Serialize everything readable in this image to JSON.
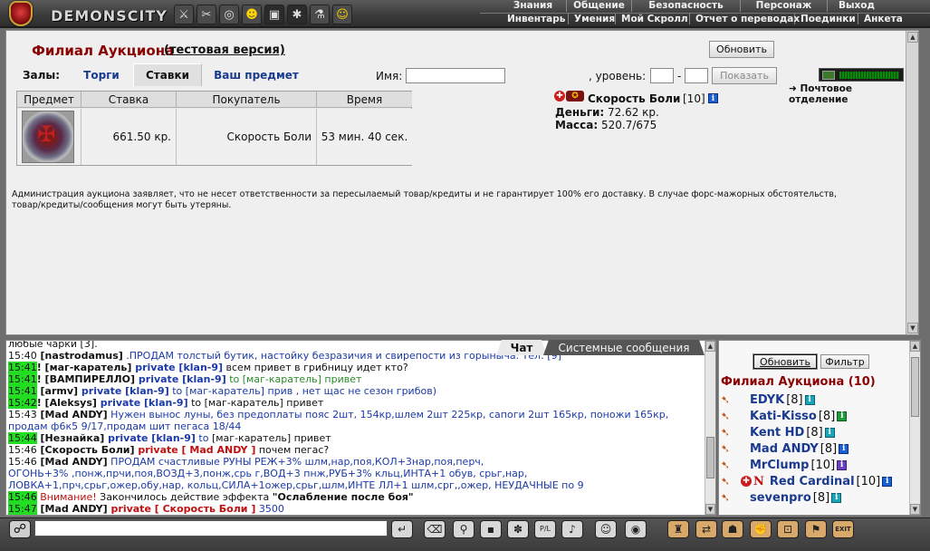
{
  "header": {
    "logo_text": "DEMONSCITY",
    "top_menu": [
      "Знания",
      "Общение",
      "Безопасность",
      "Персонаж",
      "Выход"
    ],
    "sub_menu": [
      "Инвентарь",
      "Умения",
      "Мой Скролл",
      "Отчет о переводах",
      "Поединки",
      "Анкета"
    ]
  },
  "auction": {
    "title": "Филиал Аукциона",
    "subtitle": "(тестовая версия)",
    "refresh_label": "Обновить",
    "halls_label": "Залы:",
    "tabs": [
      "Торги",
      "Ставки",
      "Ваш предмет"
    ],
    "active_tab": "Ставки",
    "name_label": "Имя:",
    "name_value": "",
    "level_label": ", уровень:",
    "level_from": "",
    "level_sep": "-",
    "level_to": "",
    "show_label": "Показать",
    "table": {
      "headers": [
        "Предмет",
        "Ставка",
        "Покупатель",
        "Время"
      ],
      "rows": [
        {
          "bid": "661.50 кр.",
          "buyer": "Скорость Боли",
          "time": "53 мин. 40 сек."
        }
      ]
    },
    "buyer": {
      "name": "Скорость Боли",
      "level": "[10]",
      "money_label": "Деньги:",
      "money_value": "72.62 кр.",
      "mass_label": "Масса:",
      "mass_value": "520.7/675"
    },
    "disclaimer": "Администрация аукциона заявляет, что не несет ответственности за пересылаемый товар/кредиты и не гарантирует 100% его доставку. В случае форс-мажорных обстоятельств, товар/кредиты/сообщения могут быть утеряны.",
    "mail_label": "Почтовое отделение"
  },
  "chat": {
    "tabs": [
      "Чат",
      "Системные сообщения"
    ],
    "lines": [
      {
        "time": "",
        "highlight": false,
        "parts": [
          {
            "t": "любые чарки [3].",
            "c": "n"
          }
        ]
      },
      {
        "time": "15:40",
        "highlight": false,
        "parts": [
          {
            "t": " [nastrodamus]",
            "c": "k"
          },
          {
            "t": " .ПРОДАМ толстый бутик, настойку безразичия и свирепости из горыныча. Тел: [9]",
            "c": "m"
          }
        ]
      },
      {
        "time": "15:41",
        "highlight": true,
        "parts": [
          {
            "t": "! [маг-каратель]",
            "c": "k"
          },
          {
            "t": " private [klan-9]",
            "c": "p"
          },
          {
            "t": " всем привет в грибницу идет кто?",
            "c": "n"
          }
        ]
      },
      {
        "time": "15:41",
        "highlight": true,
        "parts": [
          {
            "t": "! [ВАМПИРЕЛЛО]",
            "c": "k"
          },
          {
            "t": " private [klan-9]",
            "c": "p"
          },
          {
            "t": " to ",
            "c": "g"
          },
          {
            "t": "[маг-каратель] привет",
            "c": "g"
          }
        ]
      },
      {
        "time": "15:41",
        "highlight": true,
        "parts": [
          {
            "t": " [armv]",
            "c": "k"
          },
          {
            "t": " private [klan-9]",
            "c": "p"
          },
          {
            "t": " to ",
            "c": "m"
          },
          {
            "t": "[маг-каратель] прив , нет щас не сезон грибов)",
            "c": "m"
          }
        ]
      },
      {
        "time": "15:42",
        "highlight": true,
        "parts": [
          {
            "t": "! [Aleksys]",
            "c": "k"
          },
          {
            "t": " private [klan-9]",
            "c": "p"
          },
          {
            "t": " to ",
            "c": "n"
          },
          {
            "t": "[маг-каратель] привет",
            "c": "n"
          }
        ]
      },
      {
        "time": "15:43",
        "highlight": false,
        "parts": [
          {
            "t": " [Mad ANDY]",
            "c": "k"
          },
          {
            "t": " Нужен вынос луны, без предоплаты пояс 2шт, 154кр,шлем 2шт 225кр, сапоги 2шт 165кр, поножи 165кр,",
            "c": "m"
          }
        ]
      },
      {
        "time": "",
        "highlight": false,
        "parts": [
          {
            "t": "продам ф6к5 9/17,продам шит пегаса 18/44",
            "c": "m"
          }
        ]
      },
      {
        "time": "15:44",
        "highlight": true,
        "parts": [
          {
            "t": " [Незнайка]",
            "c": "k"
          },
          {
            "t": " private [klan-9]",
            "c": "p"
          },
          {
            "t": " to ",
            "c": "m"
          },
          {
            "t": "[маг-каратель] привет",
            "c": "n"
          }
        ]
      },
      {
        "time": "15:46",
        "highlight": false,
        "parts": [
          {
            "t": " [Скорость Боли]",
            "c": "k"
          },
          {
            "t": " private [ Mad ANDY ]",
            "c": "pr"
          },
          {
            "t": " почем пегас?",
            "c": "n"
          }
        ]
      },
      {
        "time": "15:46",
        "highlight": false,
        "parts": [
          {
            "t": " [Mad ANDY]",
            "c": "k"
          },
          {
            "t": " ПРОДАМ счастливые РУНЫ РЕЖ+3% шлм,нар,поя,КОЛ+3нар,поя,перч,",
            "c": "m"
          }
        ]
      },
      {
        "time": "",
        "highlight": false,
        "parts": [
          {
            "t": "ОГОНЬ+3% ,понж,прчи,поя,ВОЗД+3,понж,срь г,ВОД+3 пнж,РУБ+3% кльц,ИНТА+1 обув, срьг,нар,",
            "c": "m"
          }
        ]
      },
      {
        "time": "",
        "highlight": false,
        "parts": [
          {
            "t": "ЛОВКА+1,прч,срьг,ожер,обу,нар, кольц,СИЛА+1ожер,срьг,шлм,ИНТЕ ЛЛ+1 шлм,срг,,ожер, НЕУДАЧНЫЕ по 9",
            "c": "m"
          }
        ]
      },
      {
        "time": "15:46",
        "highlight": true,
        "parts": [
          {
            "t": " Внимание!",
            "c": "rd"
          },
          {
            "t": " Закончилось действие эффекта ",
            "c": "n"
          },
          {
            "t": "\"Ослабление после боя\"",
            "c": "k"
          }
        ]
      },
      {
        "time": "15:47",
        "highlight": true,
        "parts": [
          {
            "t": " [Mad ANDY]",
            "c": "k"
          },
          {
            "t": " private [ Скорость Боли ]",
            "c": "pr"
          },
          {
            "t": " 3500",
            "c": "m"
          }
        ]
      }
    ]
  },
  "users": {
    "refresh_label": "Обновить",
    "filter_label": "Фильтр",
    "title": "Филиал Аукциона (10)",
    "list": [
      {
        "name": "EDYK",
        "level": "[8]",
        "info": "cyan",
        "extra": ""
      },
      {
        "name": "Kati-Kisso",
        "level": "[8]",
        "info": "grn",
        "extra": ""
      },
      {
        "name": "Kent HD",
        "level": "[8]",
        "info": "cyan",
        "extra": ""
      },
      {
        "name": "Mad ANDY",
        "level": "[8]",
        "info": "blue",
        "extra": ""
      },
      {
        "name": "MrClump",
        "level": "[10]",
        "info": "vio",
        "extra": ""
      },
      {
        "name": "Red Cardinal",
        "level": "[10]",
        "info": "blue",
        "extra": "N"
      },
      {
        "name": "sevenpro",
        "level": "[8]",
        "info": "cyan",
        "extra": ""
      }
    ]
  },
  "toolbar": {
    "chat_input_value": "",
    "icons": [
      "send-icon",
      "clear-icon",
      "filter-icon",
      "save-icon",
      "dance-icon",
      "pl-icon",
      "music-icon",
      "smile-icon",
      "speaker-icon",
      "bag-icon",
      "trade-icon",
      "helmet-icon",
      "fight-icon",
      "lock-icon",
      "flag-icon",
      "exit-icon"
    ],
    "exit_label": "EXIT"
  }
}
